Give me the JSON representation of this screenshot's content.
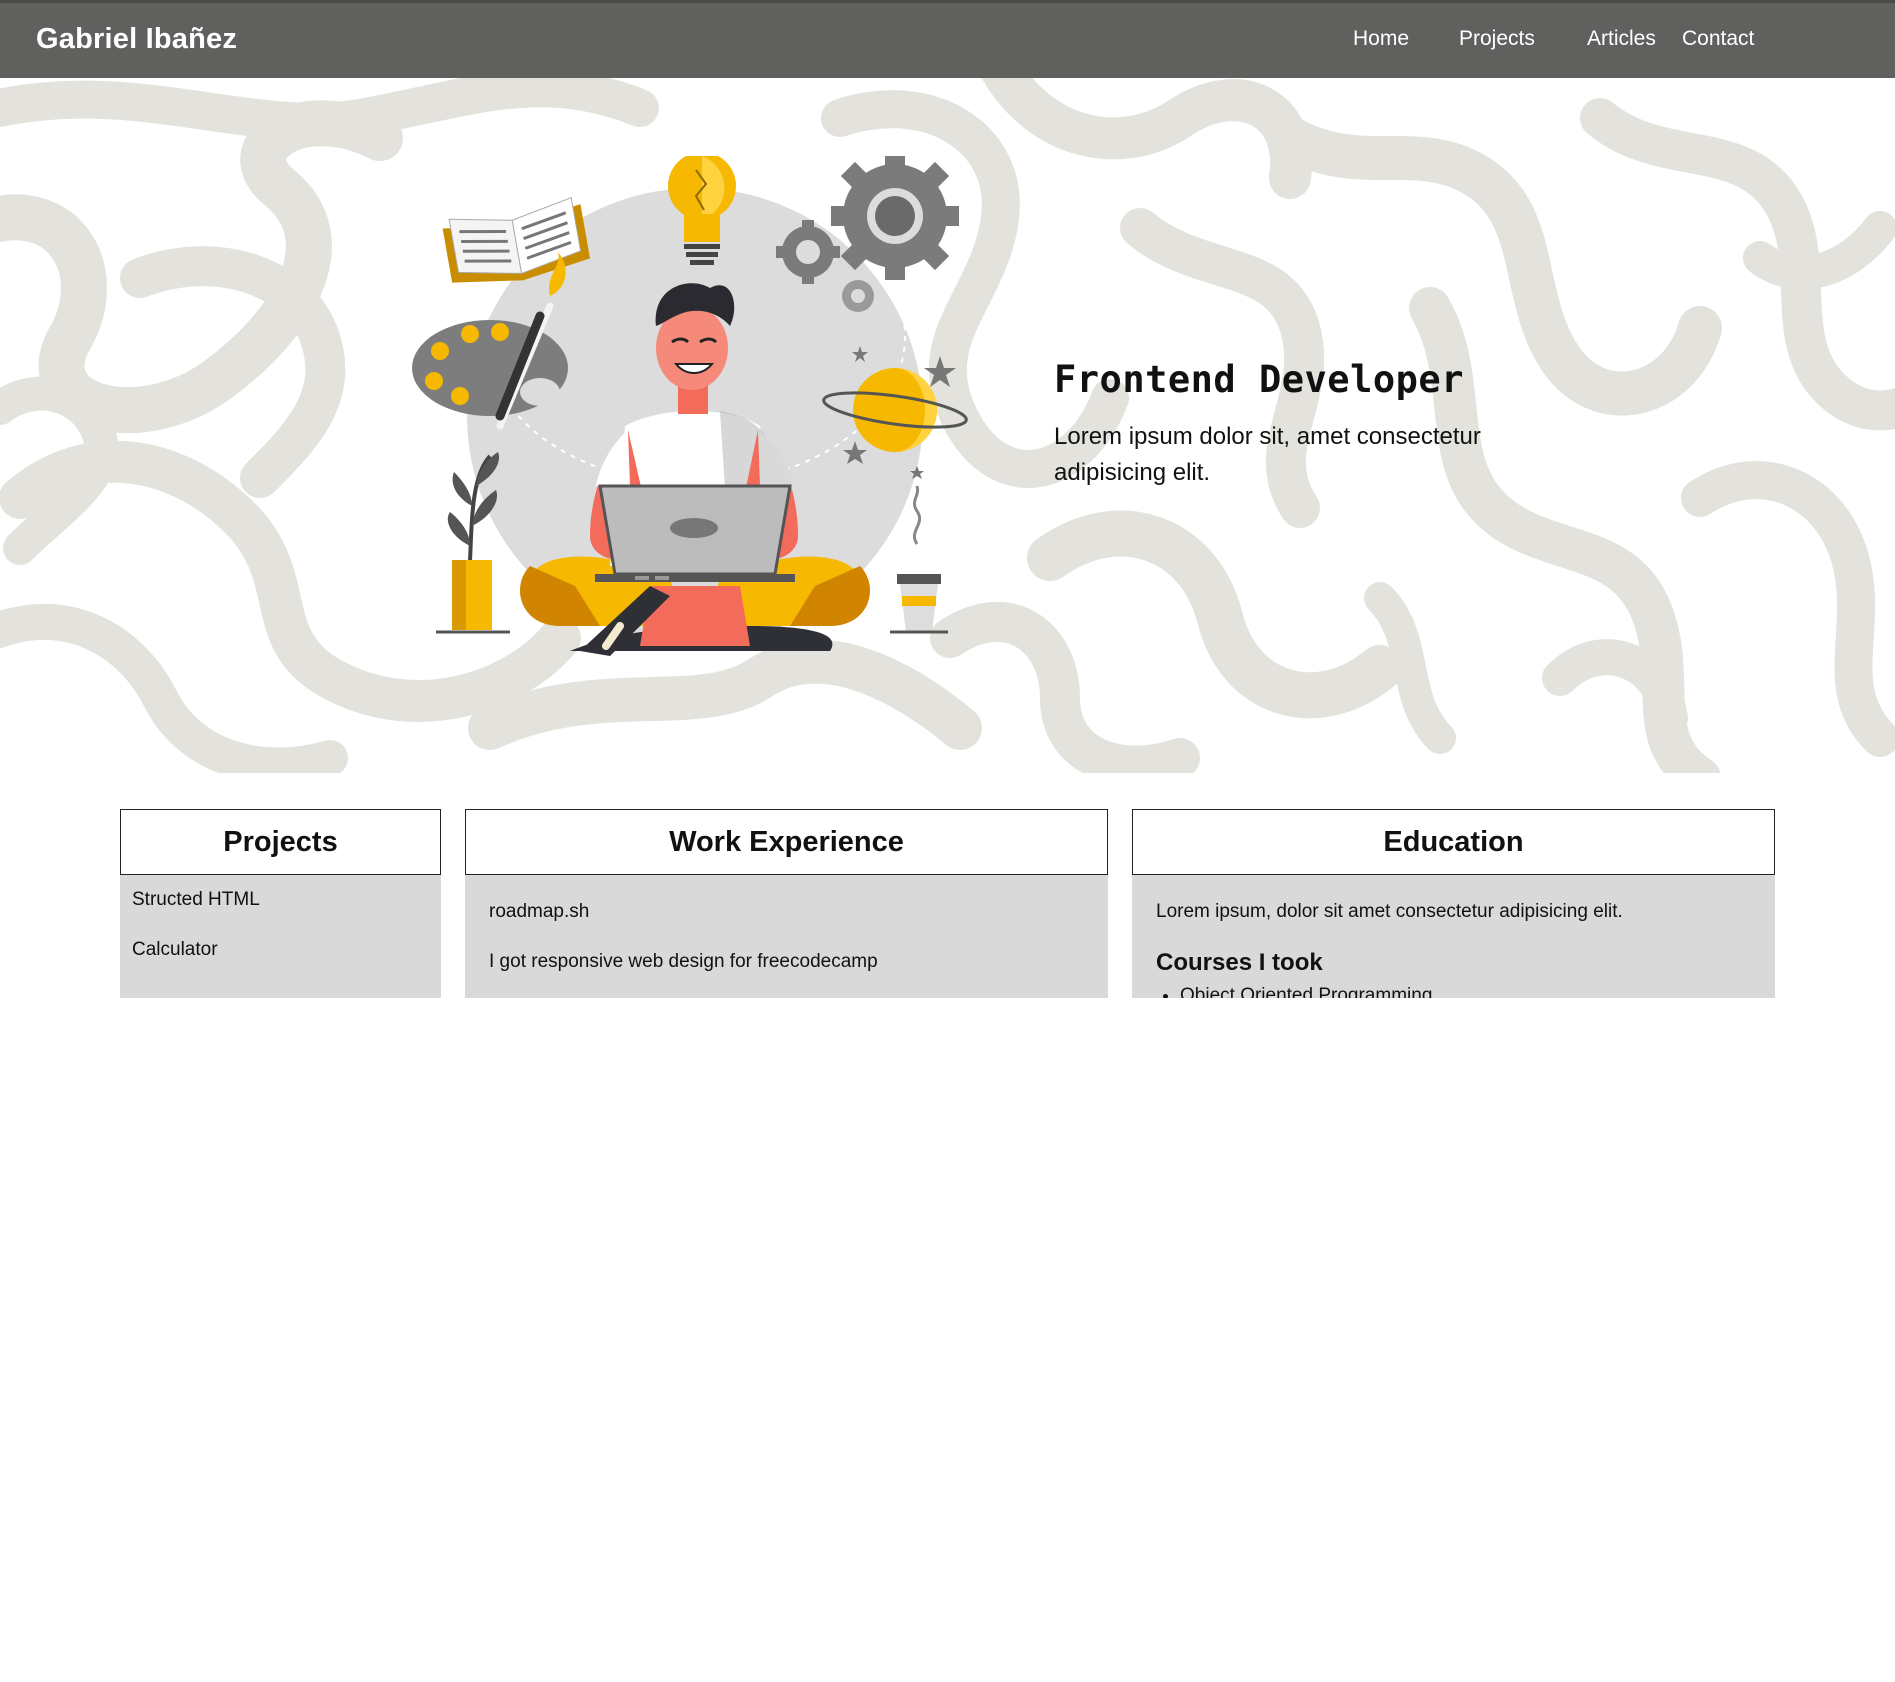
{
  "header": {
    "brand": "Gabriel Ibañez",
    "nav": [
      {
        "label": "Home"
      },
      {
        "label": "Projects"
      },
      {
        "label": "Articles"
      },
      {
        "label": "Contact"
      }
    ]
  },
  "hero": {
    "title": "Frontend Developer",
    "subtitle": "Lorem ipsum dolor sit, amet consectetur adipisicing elit."
  },
  "cards": {
    "projects": {
      "title": "Projects",
      "items": [
        "Structed HTML",
        "Calculator"
      ]
    },
    "work": {
      "title": "Work Experience",
      "items": [
        "roadmap.sh",
        "I got responsive web design for freecodecamp"
      ]
    },
    "education": {
      "title": "Education",
      "text": "Lorem ipsum, dolor sit amet consectetur adipisicing elit.",
      "courses_heading": "Courses I took",
      "courses": [
        "Object Oriented Programming"
      ]
    }
  },
  "colors": {
    "header_bg": "#60605e",
    "pattern": "#e4e2dc",
    "card_bg": "#d9d9d9",
    "accent_yellow": "#f6b800",
    "accent_coral": "#f26b5b"
  },
  "icons": [
    "book-icon",
    "lightbulb-icon",
    "gear-icon",
    "palette-icon",
    "planet-icon",
    "plant-icon",
    "coffee-cup-icon",
    "laptop-icon",
    "star-icon"
  ]
}
